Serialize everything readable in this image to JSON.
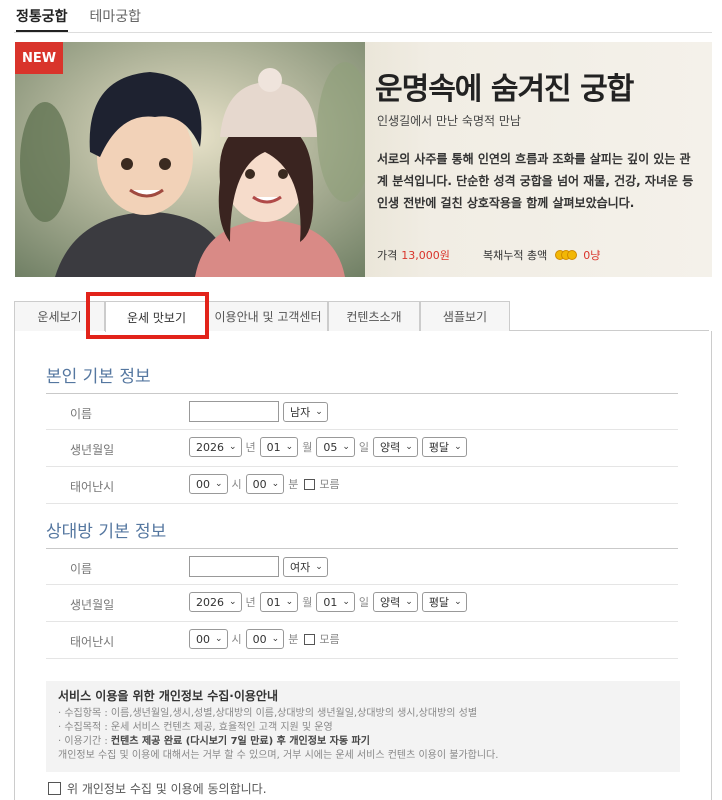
{
  "top_tabs": [
    "정통궁합",
    "테마궁합"
  ],
  "banner": {
    "badge": "NEW",
    "title": "운명속에 숨겨진 궁합",
    "subtitle": "인생길에서 만난 숙명적 만남",
    "desc_lines": [
      "서로의 사주를 통해 인연의 흐름과 조화를 살피는 깊이 있는 관",
      "계 분석입니다. 단순한 성격 궁합을 넘어 재물, 건강, 자녀운 등",
      "인생 전반에 걸친 상호작용을 함께 살펴보았습니다."
    ],
    "price_label": "가격",
    "price_value": "13,000원",
    "acc_label": "복채누적 총액",
    "acc_value": "0냥",
    "accent": "#d9342b"
  },
  "content_tabs": [
    "운세보기",
    "운세 맛보기",
    "이용안내 및 고객센터",
    "컨텐츠소개",
    "샘플보기"
  ],
  "self": {
    "title": "본인 기본 정보",
    "name_label": "이름",
    "name_value": "",
    "gender": "남자",
    "birth_label": "생년월일",
    "year": "2026",
    "year_unit": "년",
    "month": "01",
    "month_unit": "월",
    "day": "05",
    "day_unit": "일",
    "calendar": "양력",
    "leap": "평달",
    "time_label": "태어난시",
    "hour": "00",
    "hour_unit": "시",
    "minute": "00",
    "minute_unit": "분",
    "unknown_label": "모름"
  },
  "partner": {
    "title": "상대방 기본 정보",
    "name_label": "이름",
    "name_value": "",
    "gender": "여자",
    "birth_label": "생년월일",
    "year": "2026",
    "year_unit": "년",
    "month": "01",
    "month_unit": "월",
    "day": "01",
    "day_unit": "일",
    "calendar": "양력",
    "leap": "평달",
    "time_label": "태어난시",
    "hour": "00",
    "hour_unit": "시",
    "minute": "00",
    "minute_unit": "분",
    "unknown_label": "모름"
  },
  "privacy": {
    "title": "서비스 이용을 위한 개인정보 수집·이용안내",
    "items": "· 수집항목 : 이름,생년월일,생시,성별,상대방의 이름,상대방의 생년월일,상대방의 생시,상대방의 성별",
    "purpose": "· 수집목적 : 운세 서비스 컨텐츠 제공, 효율적인 고객 지원 및 운영",
    "period_prefix": "· 이용기간 : ",
    "period_bold": "컨텐츠 제공 완료 (다시보기 7일 만료) 후 개인정보 자동 파기",
    "notice": "개인정보 수집 및 이용에 대해서는 거부 할 수 있으며, 거부 시에는 운세 서비스 컨텐츠 이용이 불가합니다."
  },
  "agree_label": "위 개인정보 수집 및 이용에 동의합니다.",
  "highlight_color": "#e2231a"
}
